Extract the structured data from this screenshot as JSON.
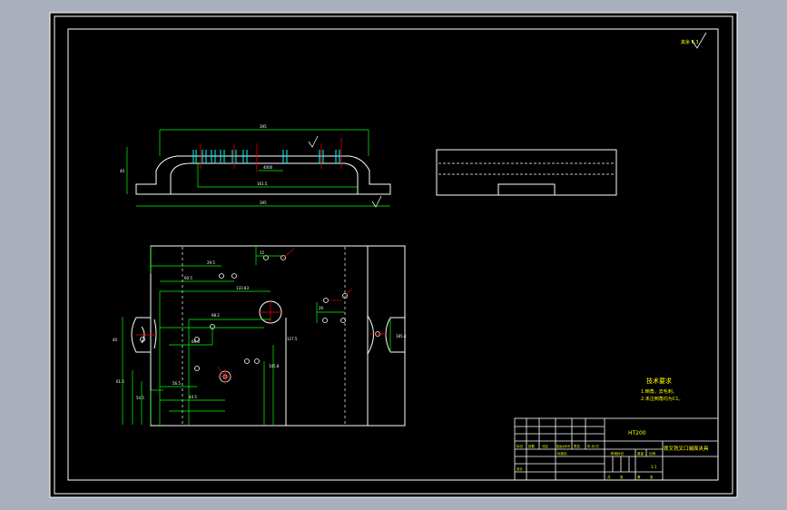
{
  "drawing": {
    "surface_roughness_top_right": "其余 6.3",
    "surface_roughness_mark": "6.3",
    "front_view": {
      "dim_top": "395",
      "dim_bottom": "395",
      "dim_inner_width": "161.5",
      "dim_slot": "4000",
      "dim_left_height": "40",
      "dim_left_step": "50"
    },
    "plan_view": {
      "dim_a": "29.5",
      "dim_b": "60.5",
      "dim_c": "98.2",
      "dim_d": "133.83",
      "dim_e": "69.5",
      "dim_f": "44.5",
      "dim_g": "105.8",
      "dim_h": "127.5",
      "dim_i": "110.8",
      "dim_j": "56.5",
      "dim_k": "40",
      "dim_l": "33.5",
      "dim_m": "61.5",
      "dim_n": "54.5",
      "dim_o": "185.4",
      "dim_p": "26",
      "dim_q": "15",
      "dim_r": "20",
      "dim_s": "120"
    },
    "tech_requirements": {
      "title": "技术要求",
      "items": [
        "1.倒角，去毛刺。",
        "2.未注倒角均为C1。"
      ]
    },
    "title_block": {
      "material": "HT200",
      "part_name": "拨叉铣叉口端面夹具",
      "scale": "1:1",
      "row_labels": [
        "标记",
        "处数",
        "分区",
        "更改文件号",
        "签名",
        "年.月.日"
      ],
      "bottom_labels": [
        "设计",
        "标准化",
        "阶段标记",
        "重量",
        "比例"
      ],
      "sheet_labels": [
        "共",
        "张",
        "第",
        "张"
      ]
    }
  }
}
